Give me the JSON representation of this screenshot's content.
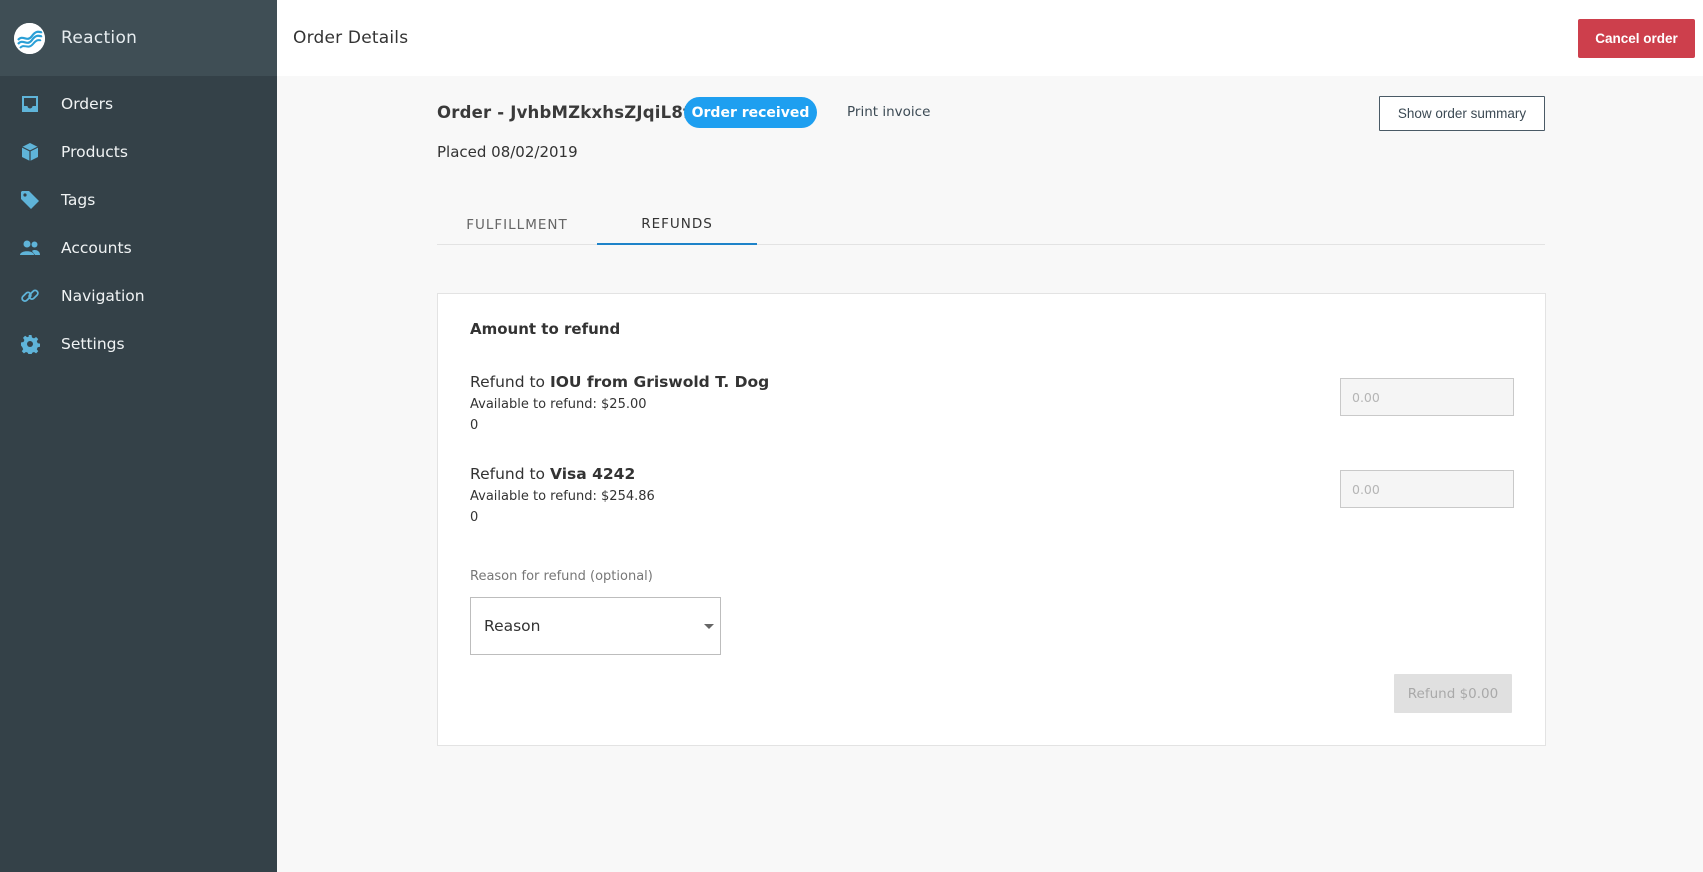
{
  "app": {
    "name": "Reaction"
  },
  "sidebar": {
    "items": [
      {
        "label": "Orders",
        "icon": "inbox-icon"
      },
      {
        "label": "Products",
        "icon": "box-icon"
      },
      {
        "label": "Tags",
        "icon": "tag-icon"
      },
      {
        "label": "Accounts",
        "icon": "people-icon"
      },
      {
        "label": "Navigation",
        "icon": "link-icon"
      },
      {
        "label": "Settings",
        "icon": "gear-icon"
      }
    ]
  },
  "header": {
    "title": "Order Details",
    "cancel_label": "Cancel order"
  },
  "order": {
    "id_label": "Order - JvhbMZkxhsZJqiL8f",
    "status": "Order received",
    "print_label": "Print invoice",
    "summary_label": "Show order summary",
    "placed": "Placed 08/02/2019"
  },
  "tabs": [
    {
      "label": "FULFILLMENT",
      "active": false
    },
    {
      "label": "REFUNDS",
      "active": true
    }
  ],
  "refund": {
    "title": "Amount to refund",
    "methods": [
      {
        "prefix": "Refund to ",
        "name": "IOU from Griswold T. Dog",
        "available": "Available to refund: $25.00",
        "value": "0",
        "placeholder": "0.00"
      },
      {
        "prefix": "Refund to ",
        "name": "Visa 4242",
        "available": "Available to refund: $254.86",
        "value": "0",
        "placeholder": "0.00"
      }
    ],
    "reason_label": "Reason for refund (optional)",
    "reason_selected": "Reason",
    "submit_label": "Refund $0.00"
  },
  "colors": {
    "sidebar_bg": "#344148",
    "accent_blue": "#1e9ff0",
    "danger": "#cd3f4c",
    "icon": "#5fb4d9"
  }
}
